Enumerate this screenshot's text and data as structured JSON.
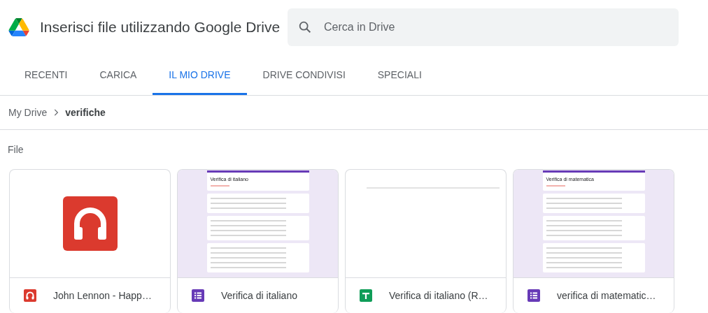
{
  "header": {
    "title": "Inserisci file utilizzando Google Drive",
    "search": {
      "placeholder": "Cerca in Drive"
    }
  },
  "tabs": [
    {
      "label": "RECENTI",
      "selected": false
    },
    {
      "label": "CARICA",
      "selected": false
    },
    {
      "label": "IL MIO DRIVE",
      "selected": true
    },
    {
      "label": "DRIVE CONDIVISI",
      "selected": false
    },
    {
      "label": "SPECIALI",
      "selected": false
    }
  ],
  "breadcrumb": [
    {
      "label": "My Drive",
      "current": false
    },
    {
      "label": "verifiche",
      "current": true
    }
  ],
  "section_label": "File",
  "files": [
    {
      "name": "John Lennon - Happ…",
      "kind": "audio",
      "preview": {
        "kind": "audio"
      }
    },
    {
      "name": "Verifica di italiano",
      "kind": "form",
      "preview": {
        "kind": "form",
        "title": "Verifica di italiano"
      }
    },
    {
      "name": "Verifica di italiano (R…",
      "kind": "sheet",
      "preview": {
        "kind": "sheet"
      }
    },
    {
      "name": "verifica di matematic…",
      "kind": "form",
      "preview": {
        "kind": "form",
        "title": "Verifica di matematica"
      }
    }
  ]
}
